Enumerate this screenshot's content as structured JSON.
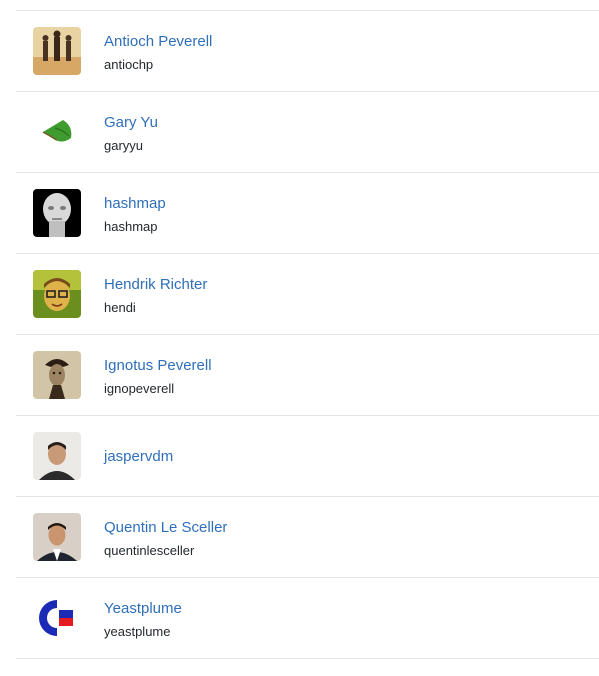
{
  "users": [
    {
      "name": "Antioch Peverell",
      "login": "antiochp"
    },
    {
      "name": "Gary Yu",
      "login": "garyyu"
    },
    {
      "name": "hashmap",
      "login": "hashmap"
    },
    {
      "name": "Hendrik Richter",
      "login": "hendi"
    },
    {
      "name": "Ignotus Peverell",
      "login": "ignopeverell"
    },
    {
      "name": "jaspervdm",
      "login": ""
    },
    {
      "name": "Quentin Le Sceller",
      "login": "quentinlesceller"
    },
    {
      "name": "Yeastplume",
      "login": "yeastplume"
    }
  ],
  "colors": {
    "link": "#2f6fba",
    "text": "#24292e",
    "divider": "#e1e4e8"
  }
}
